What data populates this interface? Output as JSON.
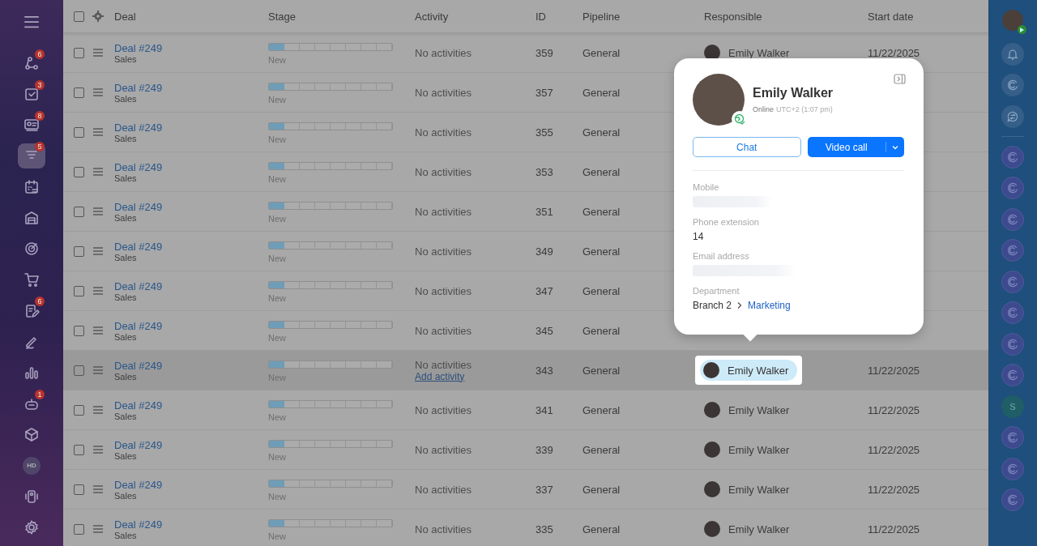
{
  "left_sidebar": {
    "items": [
      {
        "badge": "6",
        "selected": false
      },
      {
        "badge": "3",
        "selected": false
      },
      {
        "badge": "8",
        "selected": false
      },
      {
        "badge": "5",
        "selected": true
      },
      {
        "selected": false
      },
      {
        "selected": false
      },
      {
        "selected": false
      },
      {
        "selected": false
      },
      {
        "badge": "6",
        "selected": false
      },
      {
        "selected": false
      },
      {
        "selected": false
      },
      {
        "badge": "1",
        "selected": false
      },
      {
        "selected": false
      },
      {
        "label": "HD",
        "selected": false
      },
      {
        "selected": false
      }
    ]
  },
  "table": {
    "select_all_checked": false,
    "columns": [
      "Deal",
      "Stage",
      "Activity",
      "ID",
      "Pipeline",
      "Responsible",
      "Start date"
    ],
    "rows": [
      {
        "deal": "Deal #249",
        "category": "Sales",
        "stage": "New",
        "level": 0.125,
        "activity": "No activities",
        "id": "359",
        "pipeline": "General",
        "responsible": "Emily Walker",
        "start_date": "11/22/2025",
        "hovered": false
      },
      {
        "deal": "Deal #249",
        "category": "Sales",
        "stage": "New",
        "level": 0.125,
        "activity": "No activities",
        "id": "357",
        "pipeline": "General",
        "hovered": false
      },
      {
        "deal": "Deal #249",
        "category": "Sales",
        "stage": "New",
        "level": 0.125,
        "activity": "No activities",
        "id": "355",
        "pipeline": "General",
        "hovered": false
      },
      {
        "deal": "Deal #249",
        "category": "Sales",
        "stage": "New",
        "level": 0.125,
        "activity": "No activities",
        "id": "353",
        "pipeline": "General",
        "hovered": false
      },
      {
        "deal": "Deal #249",
        "category": "Sales",
        "stage": "New",
        "level": 0.125,
        "activity": "No activities",
        "id": "351",
        "pipeline": "General",
        "hovered": false
      },
      {
        "deal": "Deal #249",
        "category": "Sales",
        "stage": "New",
        "level": 0.125,
        "activity": "No activities",
        "id": "349",
        "pipeline": "General",
        "hovered": false
      },
      {
        "deal": "Deal #249",
        "category": "Sales",
        "stage": "New",
        "level": 0.125,
        "activity": "No activities",
        "id": "347",
        "pipeline": "General",
        "hovered": false
      },
      {
        "deal": "Deal #249",
        "category": "Sales",
        "stage": "New",
        "level": 0.125,
        "activity": "No activities",
        "id": "345",
        "pipeline": "General",
        "hovered": false
      },
      {
        "deal": "Deal #249",
        "category": "Sales",
        "stage": "New",
        "level": 0.125,
        "activity": "No activities",
        "add_activity": "Add activity",
        "id": "343",
        "pipeline": "General",
        "responsible": "Emily Walker",
        "start_date": "11/22/2025",
        "hovered": true
      },
      {
        "deal": "Deal #249",
        "category": "Sales",
        "stage": "New",
        "level": 0.125,
        "activity": "No activities",
        "id": "341",
        "pipeline": "General",
        "responsible": "Emily Walker",
        "start_date": "11/22/2025",
        "hovered": false
      },
      {
        "deal": "Deal #249",
        "category": "Sales",
        "stage": "New",
        "level": 0.125,
        "activity": "No activities",
        "id": "339",
        "pipeline": "General",
        "responsible": "Emily Walker",
        "start_date": "11/22/2025",
        "hovered": false
      },
      {
        "deal": "Deal #249",
        "category": "Sales",
        "stage": "New",
        "level": 0.125,
        "activity": "No activities",
        "id": "337",
        "pipeline": "General",
        "responsible": "Emily Walker",
        "start_date": "11/22/2025",
        "hovered": false
      },
      {
        "deal": "Deal #249",
        "category": "Sales",
        "stage": "New",
        "level": 0.125,
        "activity": "No activities",
        "id": "335",
        "pipeline": "General",
        "responsible": "Emily Walker",
        "start_date": "11/22/2025",
        "hovered": false
      }
    ]
  },
  "profile_popup": {
    "name": "Emily Walker",
    "status": "Online",
    "timezone": "UTC+2 (1:07 pm)",
    "chat_button": "Chat",
    "video_button": "Video call",
    "fields": [
      {
        "label": "Mobile",
        "kind": "hidden"
      },
      {
        "label": "Phone extension",
        "kind": "text",
        "value": "14"
      },
      {
        "label": "Email address",
        "kind": "hidden"
      },
      {
        "label": "Department",
        "kind": "path",
        "value": "Branch 2",
        "link": "Marketing"
      }
    ]
  },
  "right_sidebar": {
    "items": [
      {
        "kind": "bell"
      },
      {
        "kind": "copilot"
      },
      {
        "kind": "chat"
      },
      {
        "kind": "channel"
      },
      {
        "kind": "channel"
      },
      {
        "kind": "channel"
      },
      {
        "kind": "channel"
      },
      {
        "kind": "channel"
      },
      {
        "kind": "channel"
      },
      {
        "kind": "channel"
      },
      {
        "kind": "channel"
      },
      {
        "kind": "letter",
        "label": "S"
      },
      {
        "kind": "channel"
      },
      {
        "kind": "channel"
      },
      {
        "kind": "channel"
      }
    ]
  }
}
